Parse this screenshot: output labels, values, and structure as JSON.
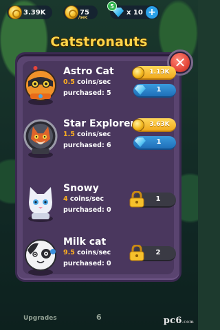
{
  "hud": {
    "coins": "3.39K",
    "rate_value": "75",
    "rate_label": "/sec",
    "gems": "x 10",
    "gem_badge": "5",
    "plus_label": "+"
  },
  "title": "Catstronauts",
  "close_label": "✕",
  "cats": [
    {
      "name": "Astro Cat",
      "rate_value": "0.5",
      "rate_unit": " coins/sec",
      "purchased": "purchased: 5",
      "coin_price": "1.13K",
      "gem_price": "1",
      "locked": false
    },
    {
      "name": "Star Explorer",
      "rate_value": "1.5",
      "rate_unit": " coins/sec",
      "purchased": "purchased: 6",
      "coin_price": "3.63K",
      "gem_price": "1",
      "locked": false
    },
    {
      "name": "Snowy",
      "rate_value": "4",
      "rate_unit": " coins/sec",
      "purchased": "purchased: 0",
      "lock_price": "1",
      "locked": true
    },
    {
      "name": "Milk cat",
      "rate_value": "9.5",
      "rate_unit": " coins/sec",
      "purchased": "purchased: 0",
      "lock_price": "2",
      "locked": true
    }
  ],
  "bottom": {
    "upgrades_label": "Upgrades",
    "center_number": "6"
  },
  "watermark": {
    "main": "pc6",
    "sub": ".com"
  },
  "colors": {
    "title": "#ffd54a",
    "rate_number": "#ffb020",
    "panel": "#5a4470",
    "close": "#e5473a"
  }
}
